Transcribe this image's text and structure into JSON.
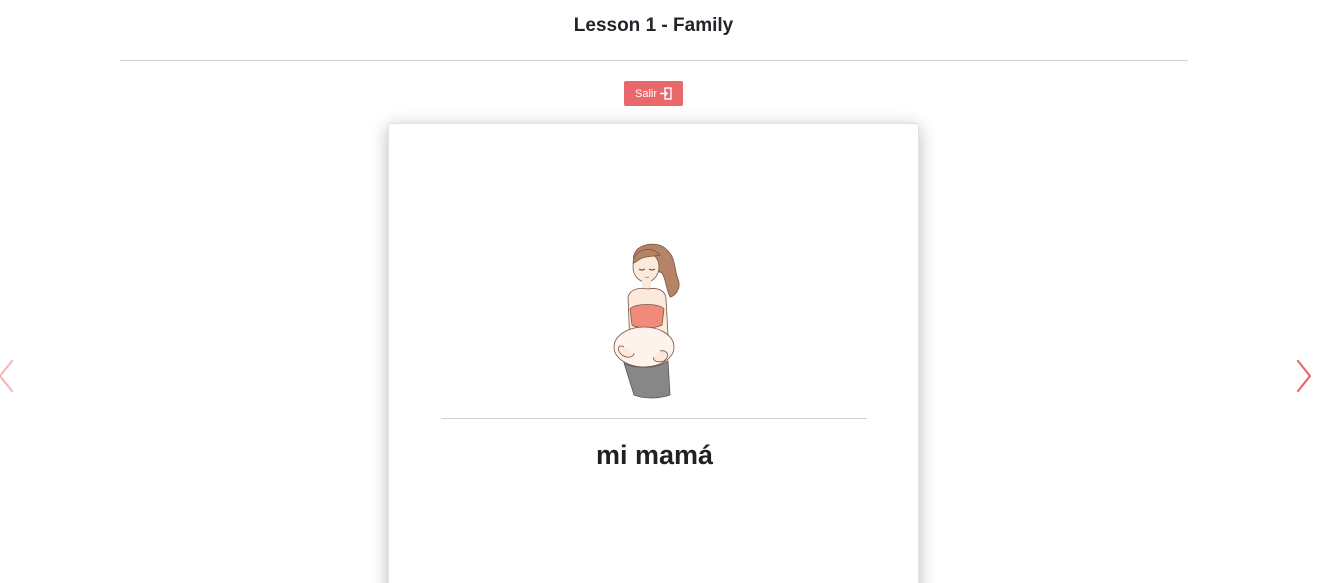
{
  "header": {
    "title": "Lesson 1 - Family"
  },
  "exit_button": {
    "label": "Salir",
    "icon": "sign-out-icon"
  },
  "flashcard": {
    "image": "pregnant-woman-illustration",
    "word": "mi mamá"
  },
  "navigation": {
    "prev_icon": "chevron-left-icon",
    "next_icon": "chevron-right-icon"
  },
  "colors": {
    "accent": "#e8686b",
    "prev_arrow": "#f4b8b8",
    "next_arrow": "#e8686b",
    "divider": "#cfcfcf"
  }
}
